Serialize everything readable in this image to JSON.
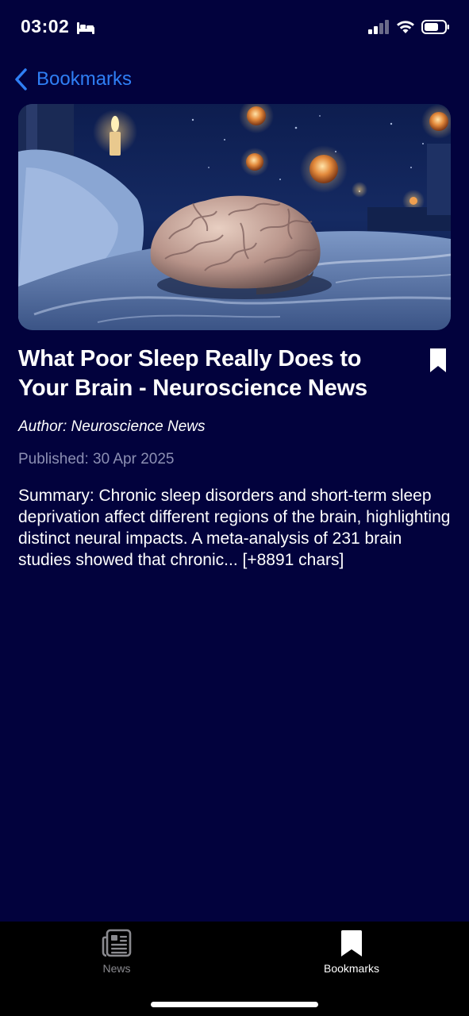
{
  "status_bar": {
    "time": "03:02",
    "icons": [
      "bed-icon",
      "signal-icon",
      "wifi-icon",
      "battery-icon"
    ]
  },
  "nav": {
    "back_label": "Bookmarks"
  },
  "article": {
    "image_icon": "brain-on-bed-image",
    "title": "What Poor Sleep Really Does to Your Brain - Neuroscience News",
    "author": "Author: Neuroscience News",
    "published": "Published: 30 Apr 2025",
    "summary": "Summary: Chronic sleep disorders and short-term sleep deprivation affect different regions of the brain, highlighting distinct neural impacts. A meta-analysis of 231 brain studies showed that chronic... [+8891 chars]",
    "bookmarked": true
  },
  "tab_bar": {
    "tabs": [
      {
        "label": "News",
        "icon": "newspaper-icon",
        "active": false
      },
      {
        "label": "Bookmarks",
        "icon": "bookmark-icon",
        "active": true
      }
    ]
  },
  "colors": {
    "background": "#02023d",
    "accent": "#2f7ff5",
    "muted_text": "#8c8fb3",
    "tab_bar": "#000000"
  }
}
